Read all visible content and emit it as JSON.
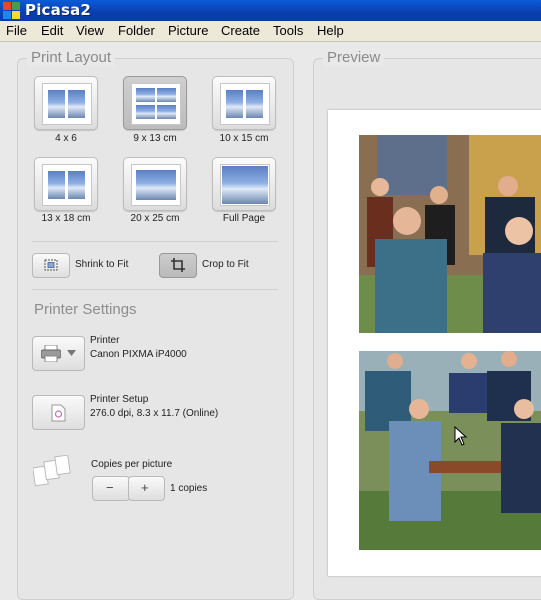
{
  "window": {
    "title": "Picasa2"
  },
  "menu": [
    "File",
    "Edit",
    "View",
    "Folder",
    "Picture",
    "Create",
    "Tools",
    "Help"
  ],
  "print_layout": {
    "title": "Print Layout",
    "options": [
      {
        "label": "4 x 6",
        "selected": false
      },
      {
        "label": "9 x 13 cm",
        "selected": true
      },
      {
        "label": "10 x 15 cm",
        "selected": false
      },
      {
        "label": "13 x 18 cm",
        "selected": false
      },
      {
        "label": "20 x 25 cm",
        "selected": false
      },
      {
        "label": "Full Page",
        "selected": false
      }
    ],
    "shrink_label": "Shrink to Fit",
    "crop_label": "Crop to Fit",
    "crop_selected": true
  },
  "printer_settings": {
    "title": "Printer Settings",
    "printer_label": "Printer",
    "printer_name": "Canon PIXMA iP4000",
    "setup_label": "Printer Setup",
    "setup_value": "276.0 dpi, 8.3 x 11.7 (Online)",
    "copies_label": "Copies per picture",
    "minus": "−",
    "plus": "+",
    "copies_value": "1 copies"
  },
  "preview": {
    "title": "Preview"
  },
  "icons": {
    "app": "picasa-logo-icon",
    "printer": "printer-icon",
    "setup": "printer-setup-icon",
    "copies": "copies-stack-icon",
    "shrink": "shrink-to-fit-icon",
    "crop": "crop-icon",
    "cursor": "mouse-pointer-icon"
  },
  "colors": {
    "titlebar": "#0a3fb0",
    "panel_bg": "#e6e6e6",
    "section_title": "#8a8a8a"
  }
}
